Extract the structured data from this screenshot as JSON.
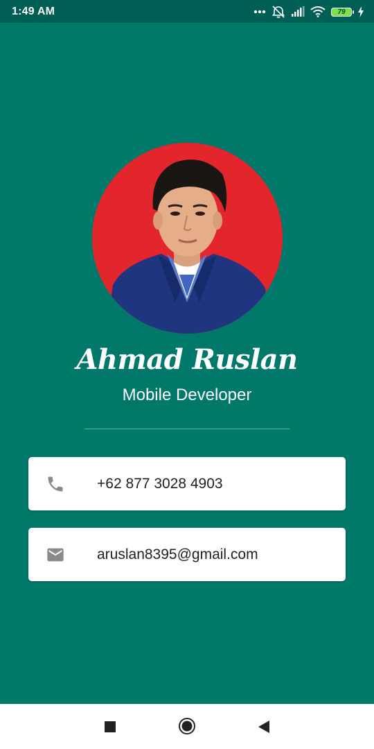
{
  "status_bar": {
    "time": "1:49 AM",
    "battery_level": "79",
    "icons": [
      "more-dots-icon",
      "alarm-off-icon",
      "signal-icon",
      "wifi-icon",
      "battery-icon",
      "charging-bolt-icon"
    ]
  },
  "profile": {
    "name": "Ahmad Ruslan",
    "title": "Mobile Developer",
    "avatar_background": "#e3262c"
  },
  "contacts": {
    "phone": {
      "icon": "phone-icon",
      "value": "+62 877 3028 4903"
    },
    "email": {
      "icon": "mail-icon",
      "value": "aruslan8395@gmail.com"
    }
  },
  "nav_bar": {
    "buttons": [
      "recents-square-icon",
      "home-circle-icon",
      "back-triangle-icon"
    ]
  },
  "colors": {
    "background": "#00796b",
    "status_bar": "#005f55",
    "card": "#ffffff",
    "icon": "#8a8a8a"
  }
}
